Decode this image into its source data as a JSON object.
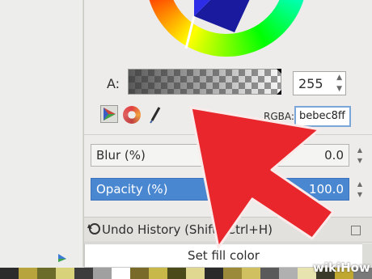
{
  "alpha": {
    "label": "A:",
    "value": "255",
    "level": 1.0
  },
  "rgba": {
    "label": "RGBA:",
    "value": "bebec8ff"
  },
  "blur": {
    "label": "Blur (%)",
    "value": "0.0"
  },
  "opacity": {
    "label": "Opacity (%)",
    "value": "100.0"
  },
  "undo": {
    "title": "Undo History (Shift+Ctrl+H)",
    "items": [
      "Set fill color"
    ]
  },
  "watermark": "wikiHow",
  "icons": [
    "triangle-mode-icon",
    "wheel-mode-icon",
    "color-picker-icon",
    "undo-history-icon",
    "close-icon",
    "corner-arrow-icon"
  ],
  "colors": {
    "highlight": "#4a87d1",
    "arrow": "#e8262b",
    "palette": [
      "#2b2b2b",
      "#b8a43c",
      "#6c6c2a",
      "#d8d27a",
      "#3c3c3c",
      "#a0a0a0",
      "#ffffff",
      "#7a6a2a",
      "#c8b84a",
      "#4a4a1a",
      "#e0d890",
      "#2a2a2a",
      "#9a8a3a",
      "#d0c060",
      "#5a5a5a",
      "#b0b0b0",
      "#e8e4b0",
      "#3a3a2a",
      "#c0a830",
      "#7a7a7a"
    ]
  }
}
